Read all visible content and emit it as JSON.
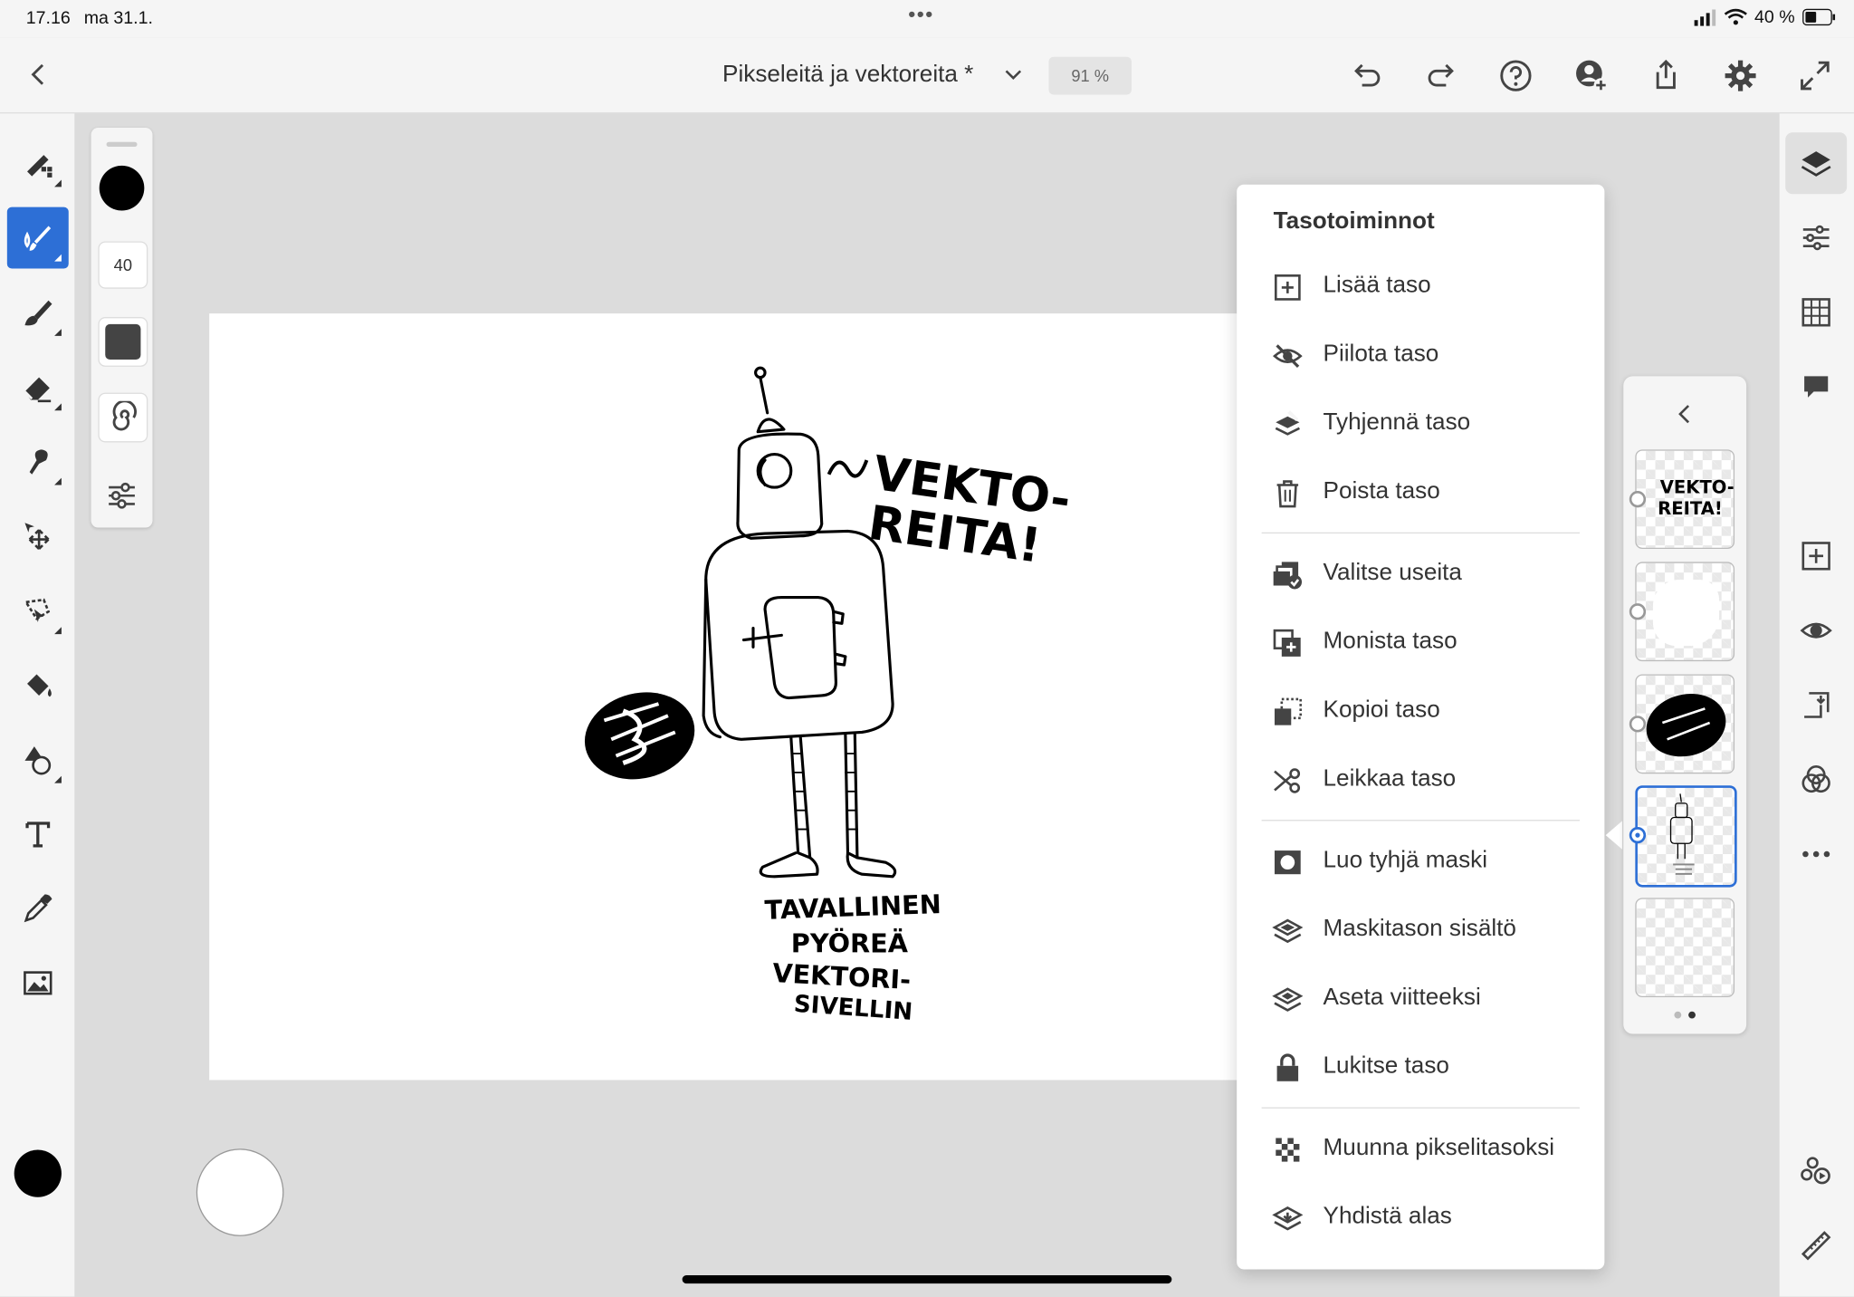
{
  "status": {
    "time": "17.16",
    "date": "ma 31.1.",
    "battery": "40 %"
  },
  "topbar": {
    "title": "Pikseleitä ja vektoreita *",
    "zoom": "91 %"
  },
  "brush": {
    "size": "40",
    "color": "#000000"
  },
  "canvas_text": {
    "shout_line1": "VEKTO-",
    "shout_line2": "REITA!",
    "caption_line1": "TAVALLINEN",
    "caption_line2": "PYÖREÄ",
    "caption_line3": "VEKTORI-",
    "caption_line4": "SIVELLIN"
  },
  "menu": {
    "title": "Tasotoiminnot",
    "items": [
      {
        "label": "Lisää taso",
        "icon": "add-layer-icon"
      },
      {
        "label": "Piilota taso",
        "icon": "hide-icon"
      },
      {
        "label": "Tyhjennä taso",
        "icon": "clear-layer-icon"
      },
      {
        "label": "Poista taso",
        "icon": "trash-icon"
      },
      {
        "label": "Valitse useita",
        "icon": "select-multiple-icon"
      },
      {
        "label": "Monista taso",
        "icon": "duplicate-icon"
      },
      {
        "label": "Kopioi taso",
        "icon": "copy-icon"
      },
      {
        "label": "Leikkaa taso",
        "icon": "scissors-icon"
      },
      {
        "label": "Luo tyhjä maski",
        "icon": "mask-icon"
      },
      {
        "label": "Maskitason sisältö",
        "icon": "mask-content-icon"
      },
      {
        "label": "Aseta viitteeksi",
        "icon": "reference-icon"
      },
      {
        "label": "Lukitse taso",
        "icon": "lock-icon"
      },
      {
        "label": "Muunna pikselitasoksi",
        "icon": "pixel-icon"
      },
      {
        "label": "Yhdistä alas",
        "icon": "merge-down-icon"
      }
    ]
  },
  "layers": {
    "thumb1_line1": "VEKTO-",
    "thumb1_line2": "REITA!",
    "selected_index": 3
  },
  "colors": {
    "accent": "#2d6fd6",
    "toolbar_bg": "#f5f5f5",
    "workspace_bg": "#dcdcdc"
  }
}
